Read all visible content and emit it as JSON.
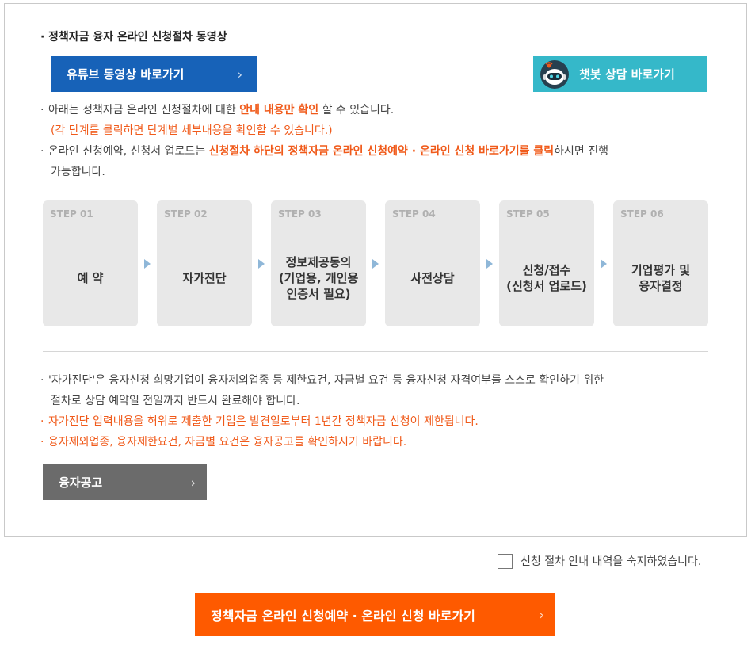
{
  "section_title": "정책자금 융자 온라인 신청절차 동영상",
  "buttons": {
    "youtube": "유튜브 동영상 바로가기",
    "chatbot": "챗봇 상담 바로가기",
    "notice": "융자공고",
    "main": "정책자금 온라인 신청예약 · 온라인 신청 바로가기"
  },
  "intro": {
    "line1_pre": "아래는 정책자금 온라인 신청절차에 대한 ",
    "line1_hl": "안내 내용만 확인",
    "line1_post": " 할 수 있습니다.",
    "line1_sub": "(각 단계를 클릭하면 단계별 세부내용을 확인할 수 있습니다.)",
    "line2_pre": "온라인 신청예약, 신청서 업로드는 ",
    "line2_hl": "신청절차 하단의 정책자금 온라인 신청예약 · 온라인 신청 바로가기를 클릭",
    "line2_post": "하시면 진행",
    "line2_cont": "가능합니다."
  },
  "steps": [
    {
      "num": "STEP 01",
      "label": "예   약"
    },
    {
      "num": "STEP 02",
      "label": "자가진단"
    },
    {
      "num": "STEP 03",
      "label": "정보제공동의\n(기업용, 개인용\n인증서 필요)"
    },
    {
      "num": "STEP 04",
      "label": "사전상담"
    },
    {
      "num": "STEP 05",
      "label": "신청/접수\n(신청서 업로드)"
    },
    {
      "num": "STEP 06",
      "label": "기업평가 및\n융자결정"
    }
  ],
  "notes": {
    "n1": "'자가진단'은 융자신청 희망기업이 융자제외업종 등 제한요건, 자금별 요건 등 융자신청 자격여부를 스스로 확인하기 위한",
    "n1_cont": "절차로 상담 예약일 전일까지 반드시 완료해야 합니다.",
    "n2": "자가진단 입력내용을 허위로 제출한 기업은 발견일로부터 1년간 정책자금 신청이 제한됩니다.",
    "n3": "융자제외업종, 융자제한요건, 자금별 요건은 융자공고를 확인하시기 바랍니다."
  },
  "agree_label": "신청 절차 안내 내역을 숙지하였습니다.",
  "colors": {
    "youtube_btn": "#1762b8",
    "chatbot_btn": "#35b8c9",
    "notice_btn": "#6b6b6b",
    "main_btn": "#fe5a00",
    "highlight": "#f05a1a"
  }
}
